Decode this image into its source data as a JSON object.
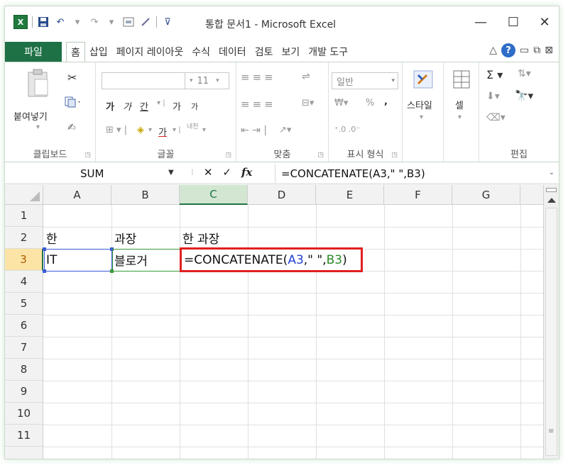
{
  "window": {
    "title": "통합 문서1 - Microsoft Excel",
    "minimize_icon": "—",
    "maximize_icon": "☐",
    "close_icon": "✕"
  },
  "qat": {
    "app_icon": "X",
    "save_icon": "💾",
    "undo_icon": "↶",
    "redo_icon": "↷"
  },
  "tabs": {
    "file": "파일",
    "items": [
      "홈",
      "삽입",
      "페이지 레이아웃",
      "수식",
      "데이터",
      "검토",
      "보기",
      "개발 도구"
    ]
  },
  "ribbon": {
    "clipboard": {
      "label": "클립보드",
      "paste": "붙여넣기"
    },
    "font": {
      "label": "글꼴",
      "font_name": "",
      "font_size": "11",
      "bold": "가",
      "italic": "가",
      "underline": "간",
      "grow": "가",
      "shrink": "가",
      "text_color": "가",
      "phonetic": "내천"
    },
    "alignment": {
      "label": "맞춤"
    },
    "number": {
      "label": "표시 형식",
      "format": "일반",
      "percent": "%",
      "comma": ","
    },
    "styles": {
      "label": "스타일"
    },
    "cells": {
      "label": "셀"
    },
    "editing": {
      "label": "편집"
    }
  },
  "formula_bar": {
    "name_box": "SUM",
    "cancel": "✕",
    "enter": "✓",
    "fx": "fx",
    "formula": "=CONCATENATE(A3,\" \",B3)"
  },
  "sheet": {
    "columns": [
      "A",
      "B",
      "C",
      "D",
      "E",
      "F",
      "G"
    ],
    "rows": [
      "1",
      "2",
      "3",
      "4",
      "5",
      "6",
      "7",
      "8",
      "9",
      "10",
      "11"
    ],
    "cells": {
      "A2": "한",
      "B2": "과장",
      "C2": "한 과장",
      "A3": "IT",
      "B3": "블로거"
    },
    "active_formula": {
      "prefix": "=CONCATENATE(",
      "ref1": "A3",
      "mid": ",\" \",",
      "ref2": "B3",
      "suffix": ")"
    }
  },
  "colors": {
    "excel_green": "#217346",
    "ref_blue": "#2040d0",
    "ref_green": "#2a8a2a",
    "highlight_red": "#e02020"
  }
}
